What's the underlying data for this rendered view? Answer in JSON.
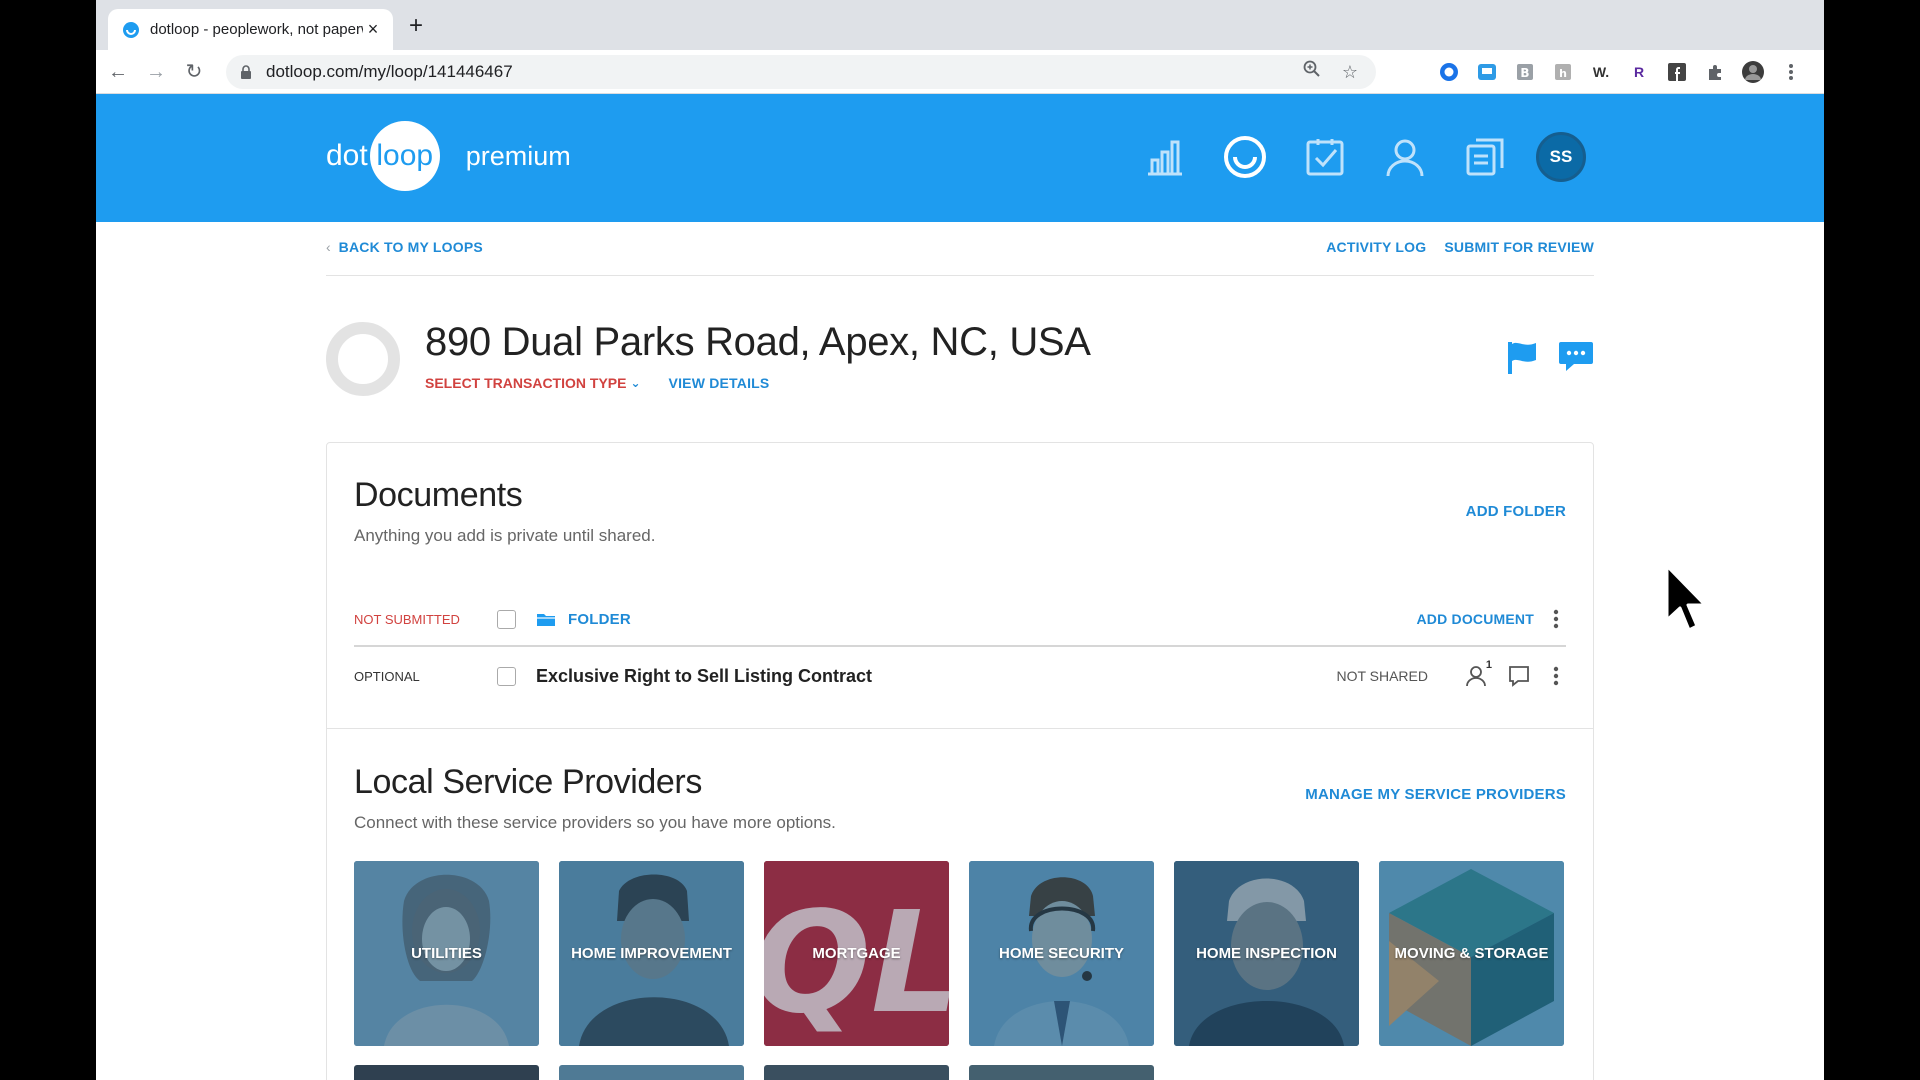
{
  "browser": {
    "tab_title": "dotloop - peoplework, not paperwork",
    "url": "dotloop.com/my/loop/141446467"
  },
  "header": {
    "logo_dot": "dot",
    "logo_loop": "loop",
    "logo_premium": "premium",
    "avatar_initials": "SS",
    "brand_color": "#1e9cf0"
  },
  "subnav": {
    "back_label": "BACK TO MY LOOPS",
    "activity_log": "ACTIVITY LOG",
    "submit_review": "SUBMIT FOR REVIEW"
  },
  "loop": {
    "title": "890 Dual Parks Road, Apex, NC, USA",
    "select_type": "SELECT TRANSACTION TYPE",
    "view_details": "VIEW DETAILS"
  },
  "documents": {
    "title": "Documents",
    "subtitle": "Anything you add is private until shared.",
    "add_folder": "ADD FOLDER",
    "folder_row": {
      "status": "NOT SUBMITTED",
      "name": "FOLDER",
      "add_document": "ADD DOCUMENT"
    },
    "doc_row": {
      "status": "OPTIONAL",
      "name": "Exclusive Right to Sell Listing Contract",
      "share_status": "NOT SHARED",
      "people_count": "1"
    }
  },
  "providers": {
    "title": "Local Service Providers",
    "subtitle": "Connect with these service providers so you have more options.",
    "manage": "MANAGE MY SERVICE PROVIDERS",
    "tiles": [
      {
        "label": "UTILITIES"
      },
      {
        "label": "HOME IMPROVEMENT"
      },
      {
        "label": "MORTGAGE"
      },
      {
        "label": "HOME SECURITY"
      },
      {
        "label": "HOME INSPECTION"
      },
      {
        "label": "MOVING & STORAGE"
      }
    ],
    "mortgage_logo": "QL"
  }
}
